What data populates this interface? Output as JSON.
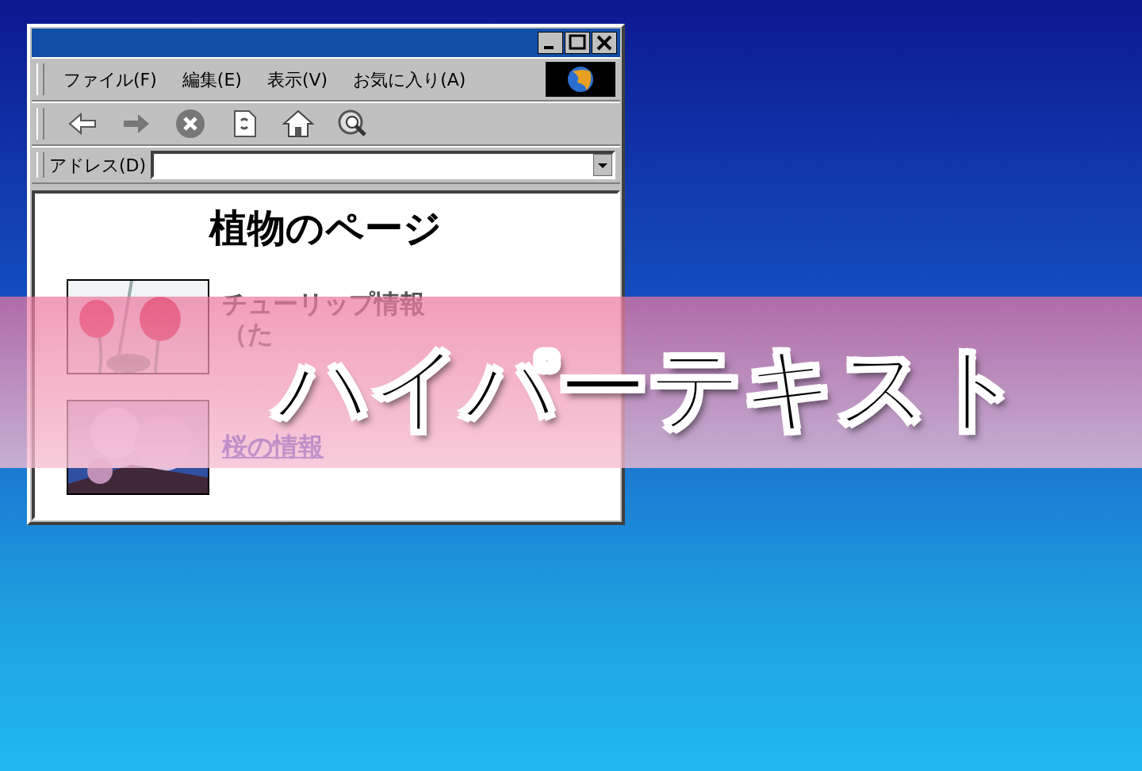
{
  "browser": {
    "menu": [
      "ファイル(F)",
      "編集(E)",
      "表示(V)",
      "お気に入り(A)"
    ],
    "address": {
      "label": "アドレス(D)"
    },
    "page": {
      "heading": "植物のページ",
      "entries": [
        {
          "lines": [
            "チューリップ情報",
            "（た"
          ],
          "linked": false
        },
        {
          "lines": [
            "桜の情報"
          ],
          "linked": true
        }
      ]
    }
  },
  "banner": {
    "text": "ハイパーテキスト"
  }
}
